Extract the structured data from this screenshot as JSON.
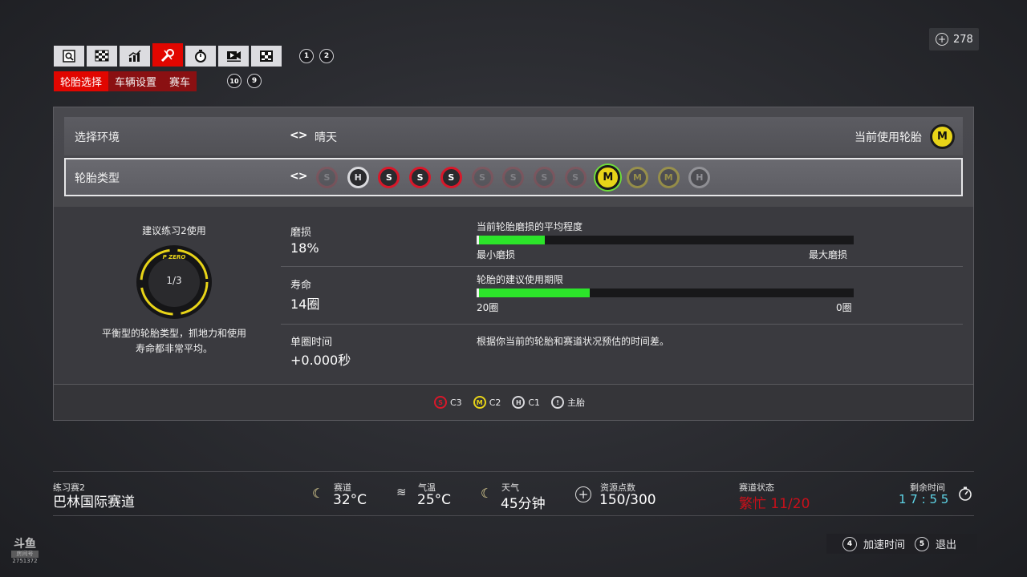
{
  "top_tabs": [
    {
      "icon": "search-icon",
      "active": false
    },
    {
      "icon": "checkered-flag-icon",
      "active": false
    },
    {
      "icon": "chart-icon",
      "active": false
    },
    {
      "icon": "wrench-icon",
      "active": true
    },
    {
      "icon": "stopwatch-icon",
      "active": false
    },
    {
      "icon": "video-icon",
      "active": false
    },
    {
      "icon": "grid-icon",
      "active": false
    }
  ],
  "tab_hints": [
    "1",
    "2"
  ],
  "sub_tabs": [
    {
      "label": "轮胎选择",
      "active": true
    },
    {
      "label": "车辆设置",
      "active": false
    },
    {
      "label": "赛车",
      "active": false
    }
  ],
  "sub_tab_hints": [
    "10",
    "9"
  ],
  "currency": {
    "value": "278"
  },
  "env_row": {
    "label": "选择环境",
    "value": "晴天",
    "current_label": "当前使用轮胎",
    "current_compound": "M"
  },
  "tyre_row": {
    "label": "轮胎类型",
    "tyres": [
      {
        "compound": "S",
        "state": "faint"
      },
      {
        "compound": "H",
        "state": "normal"
      },
      {
        "compound": "S",
        "state": "normal"
      },
      {
        "compound": "S",
        "state": "normal"
      },
      {
        "compound": "S",
        "state": "normal"
      },
      {
        "compound": "S",
        "state": "faint"
      },
      {
        "compound": "S",
        "state": "faint"
      },
      {
        "compound": "S",
        "state": "faint"
      },
      {
        "compound": "S",
        "state": "faint"
      },
      {
        "compound": "M",
        "state": "selected"
      },
      {
        "compound": "M",
        "state": "dim"
      },
      {
        "compound": "M",
        "state": "dim"
      },
      {
        "compound": "H",
        "state": "dim"
      }
    ]
  },
  "recommend": {
    "title": "建议练习2使用",
    "count": "1/3",
    "desc_line1": "平衡型的轮胎类型，抓地力和使用",
    "desc_line2": "寿命都非常平均。"
  },
  "stats": {
    "wear_label": "磨损",
    "wear_value": "18%",
    "wear_bar_title": "当前轮胎磨损的平均程度",
    "wear_fill": 0.18,
    "wear_min": "最小磨损",
    "wear_max": "最大磨损",
    "life_label": "寿命",
    "life_value": "14圈",
    "life_bar_title": "轮胎的建议使用期限",
    "life_fill": 0.3,
    "life_left": "20圈",
    "life_right": "0圈",
    "lap_label": "单圈时间",
    "lap_value": "+0.000秒",
    "lap_desc": "根据你当前的轮胎和赛道状况预估的时间差。"
  },
  "legend": [
    {
      "symbol": "S",
      "label": "C3",
      "color": "#d8182a"
    },
    {
      "symbol": "M",
      "label": "C2",
      "color": "#e8d418"
    },
    {
      "symbol": "H",
      "label": "C1",
      "color": "#d9d9dd"
    },
    {
      "symbol": "!",
      "label": "主胎",
      "color": "#d9d9dd"
    }
  ],
  "session": {
    "name": "练习赛2",
    "track": "巴林国际赛道"
  },
  "weather": {
    "track_label": "赛道",
    "track_value": "32°C",
    "air_label": "气温",
    "air_value": "25°C",
    "weather_label": "天气",
    "weather_value": "45分钟",
    "resource_label": "资源点数",
    "resource_value": "150/300",
    "status_label": "赛道状态",
    "status_value": "繁忙 11/20",
    "status_color": "#c8101a",
    "time_label": "剩余时间",
    "time_value": "1 7 : 5 5",
    "time_color": "#5fd6e8"
  },
  "bottom_hints": [
    {
      "key": "4",
      "label": "加速时间"
    },
    {
      "key": "5",
      "label": "退出"
    }
  ],
  "watermark": {
    "logo": "斗鱼",
    "sub": "房间号",
    "room": "2751372"
  }
}
